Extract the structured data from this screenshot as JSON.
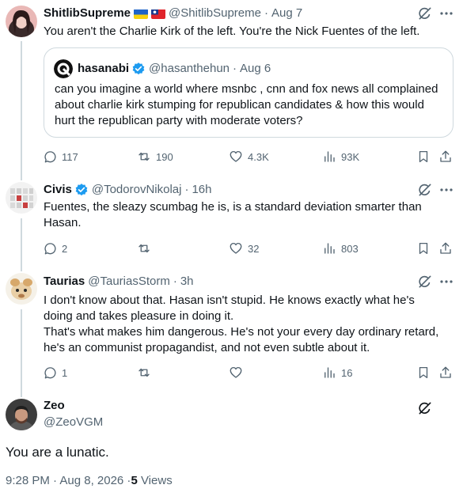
{
  "tweets": [
    {
      "name": "ShitlibSupreme",
      "flags": [
        "ukraine-flag",
        "taiwan-flag"
      ],
      "handle": "@ShitlibSupreme",
      "time": "Aug 7",
      "text": "You aren't the Charlie Kirk of the left. You're the Nick Fuentes of the left.",
      "quote": {
        "name": "hasanabi",
        "verified": true,
        "handle": "@hasanthehun",
        "time": "Aug 6",
        "text": "can you imagine a world where msnbc , cnn and fox news all complained about charlie kirk stumping for republican candidates & how this would hurt the republican party with moderate voters?"
      },
      "replies": "117",
      "reposts": "190",
      "likes": "4.3K",
      "views": "93K"
    },
    {
      "name": "Civis",
      "verified": true,
      "handle": "@TodorovNikolaj",
      "time": "16h",
      "text": "Fuentes, the sleazy scumbag he is, is a standard deviation smarter than Hasan.",
      "replies": "2",
      "reposts": "",
      "likes": "32",
      "views": "803"
    },
    {
      "name": "Taurias",
      "handle": "@TauriasStorm",
      "time": "3h",
      "text1": "I don't know about that. Hasan isn't stupid. He knows exactly what he's doing and takes pleasure in doing it.",
      "text2": "That's what makes him dangerous. He's not your every day ordinary retard, he's an communist propagandist, and not even subtle about it.",
      "replies": "1",
      "reposts": "",
      "likes": "",
      "views": "16"
    }
  ],
  "main": {
    "name": "Zeo",
    "handle": "@ZeoVGM",
    "text": "You are a lunatic.",
    "timestamp": "9:28 PM · Aug 8, 2026 · ",
    "views_count": "5",
    "views_label": " Views"
  },
  "colors": {
    "text": "#0f1419",
    "secondary": "#536471",
    "border": "#cfd9de",
    "verified": "#1d9bf0"
  }
}
